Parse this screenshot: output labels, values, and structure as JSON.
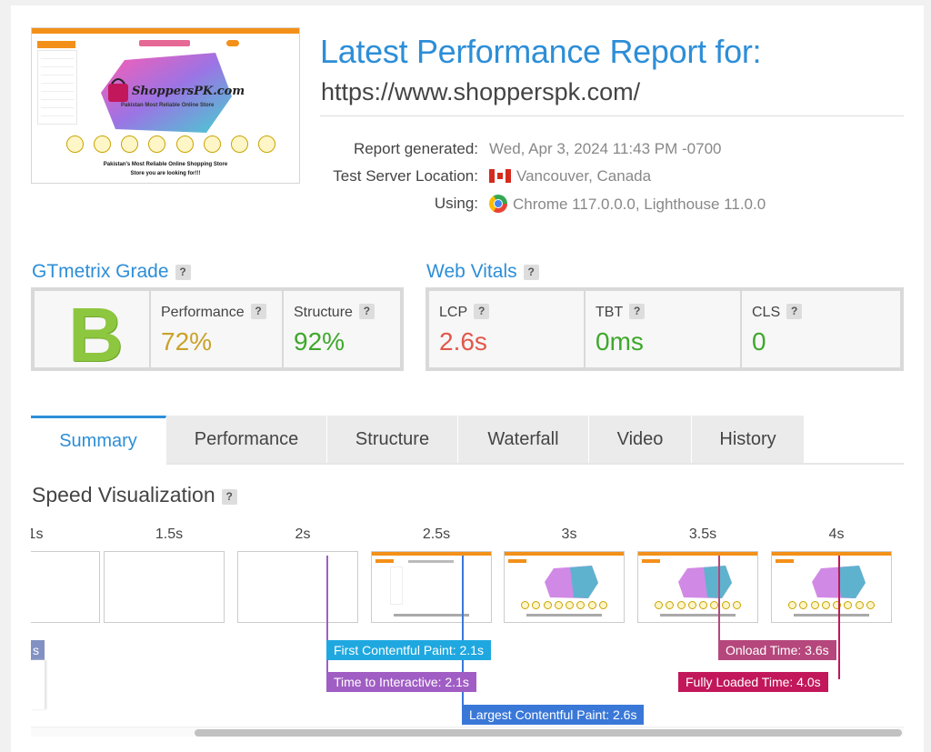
{
  "header": {
    "title": "Latest Performance Report for:",
    "url": "https://www.shopperspk.com/",
    "meta": [
      {
        "key": "Report generated:",
        "value": "Wed, Apr 3, 2024 11:43 PM -0700",
        "icon": ""
      },
      {
        "key": "Test Server Location:",
        "value": "Vancouver, Canada",
        "icon": "canada-flag-icon"
      },
      {
        "key": "Using:",
        "value": "Chrome 117.0.0.0, Lighthouse 11.0.0",
        "icon": "chrome-icon"
      }
    ],
    "thumbnail": {
      "logo_text": "ShoppersPK.com",
      "tagline": "Pakistan Most Reliable Online Store",
      "caption_1": "Pakistan's Most Reliable Online Shopping Store",
      "caption_2": "Store you are looking for!!!"
    }
  },
  "grade": {
    "title": "GTmetrix Grade",
    "help": "?",
    "letter": "B",
    "performance": {
      "label": "Performance",
      "value": "72%",
      "color": "#c9a22a"
    },
    "structure": {
      "label": "Structure",
      "value": "92%",
      "color": "#3ea82c"
    }
  },
  "vitals": {
    "title": "Web Vitals",
    "help": "?",
    "items": [
      {
        "label": "LCP",
        "value": "2.6s",
        "color": "#e2574c"
      },
      {
        "label": "TBT",
        "value": "0ms",
        "color": "#3ea82c"
      },
      {
        "label": "CLS",
        "value": "0",
        "color": "#3ea82c"
      }
    ]
  },
  "tabs": [
    {
      "label": "Summary",
      "active": true
    },
    {
      "label": "Performance",
      "active": false
    },
    {
      "label": "Structure",
      "active": false
    },
    {
      "label": "Waterfall",
      "active": false
    },
    {
      "label": "Video",
      "active": false
    },
    {
      "label": "History",
      "active": false
    }
  ],
  "speed": {
    "title": "Speed Visualization",
    "help": "?",
    "ticks": [
      "1s",
      "1.5s",
      "2s",
      "2.5s",
      "3s",
      "3.5s",
      "4s"
    ],
    "stub_label": "s",
    "markers": {
      "fcp": {
        "label": "First Contentful Paint: 2.1s",
        "color": "#1fa8e0"
      },
      "tti": {
        "label": "Time to Interactive: 2.1s",
        "color": "#a05ec4"
      },
      "lcp": {
        "label": "Largest Contentful Paint: 2.6s",
        "color": "#3a78d8"
      },
      "onload": {
        "label": "Onload Time: 3.6s",
        "color": "#b5477c"
      },
      "fully": {
        "label": "Fully Loaded Time: 4.0s",
        "color": "#c2185b"
      }
    }
  }
}
